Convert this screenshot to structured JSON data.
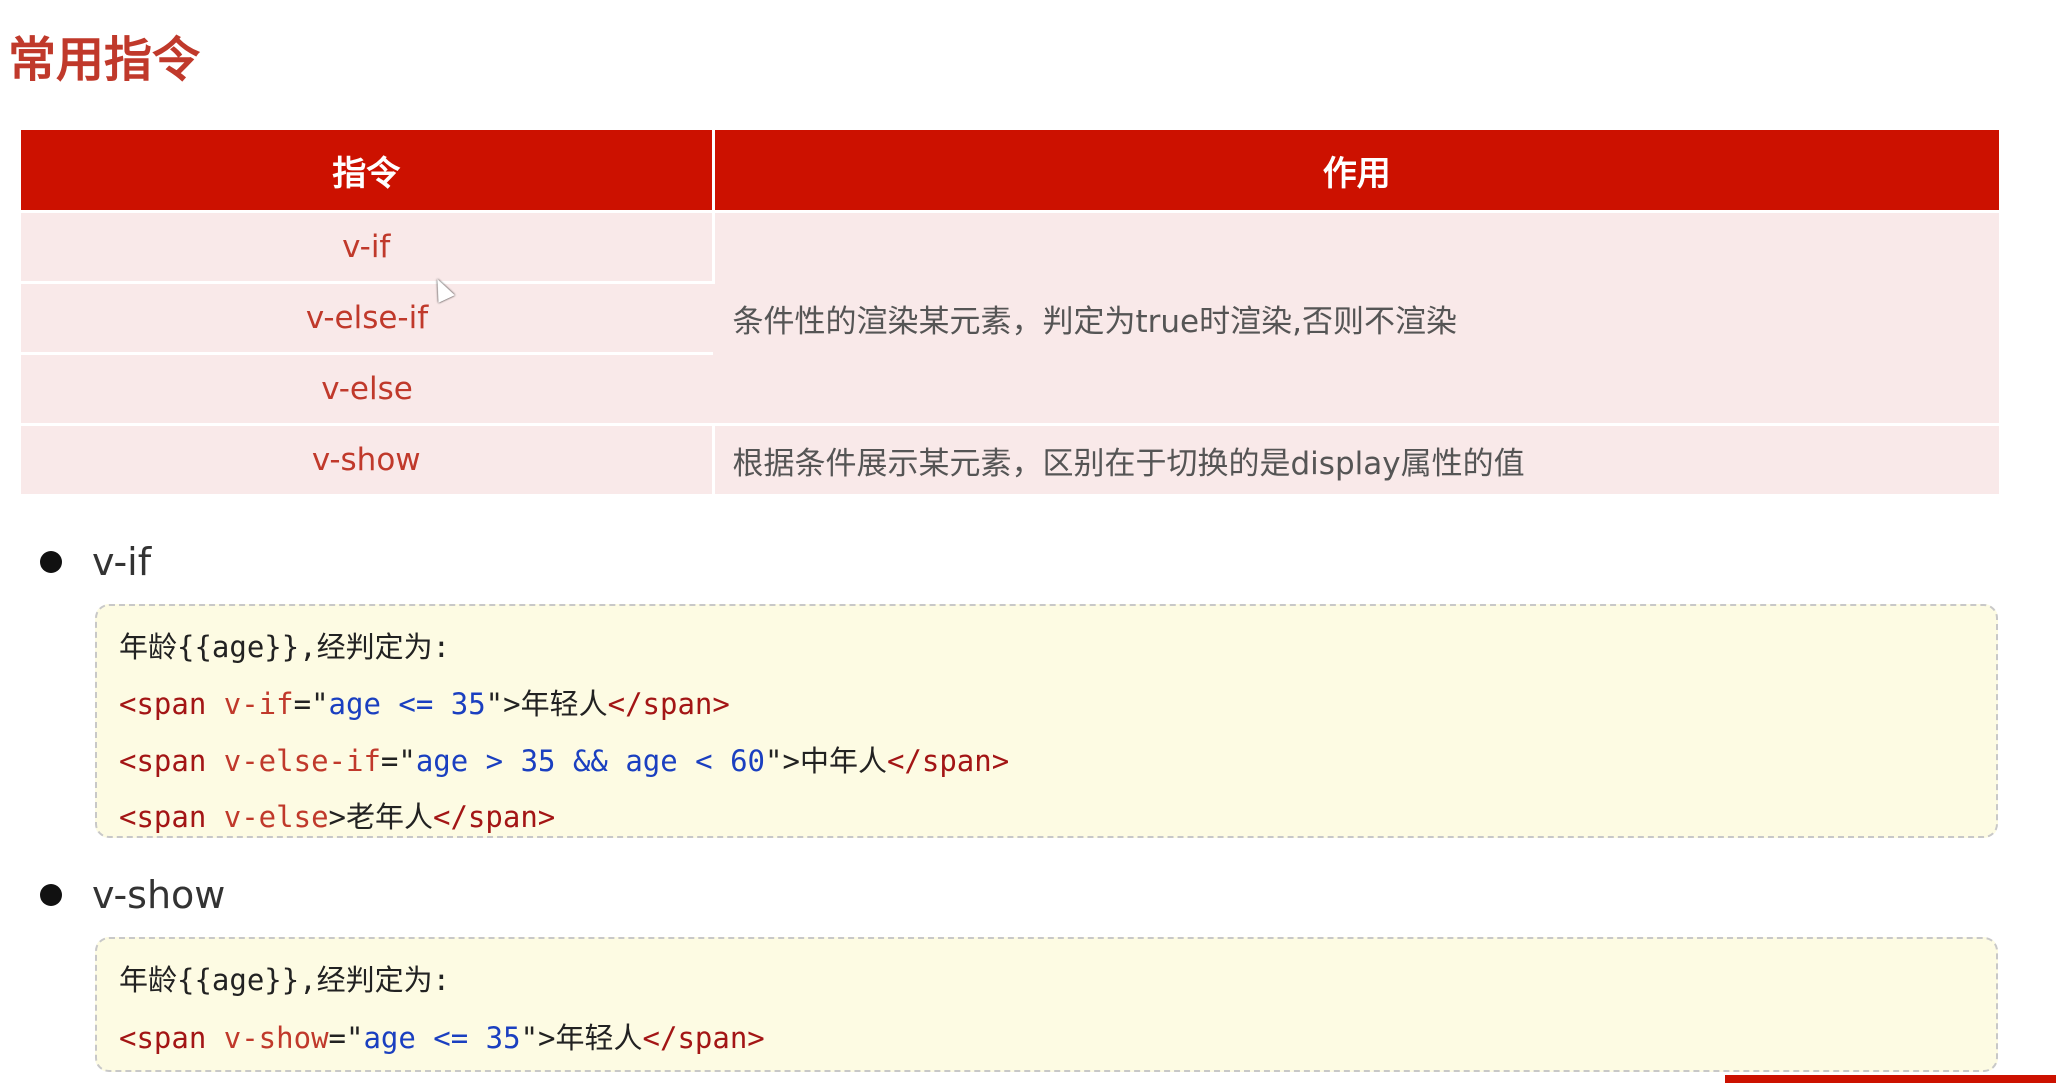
{
  "title": "常用指令",
  "table": {
    "headers": [
      "指令",
      "作用"
    ],
    "rows": [
      {
        "directive": "v-if"
      },
      {
        "directive": "v-else-if"
      },
      {
        "directive": "v-else"
      },
      {
        "directive": "v-show",
        "description": "根据条件展示某元素，区别在于切换的是display属性的值"
      }
    ],
    "merged_description": "条件性的渲染某元素，判定为true时渲染,否则不渲染"
  },
  "sections": [
    {
      "heading": "v-if",
      "code_lines": [
        [
          {
            "t": "年龄{{age}},经判定为:",
            "c": "plain"
          }
        ],
        [
          {
            "t": "<span ",
            "c": "tag"
          },
          {
            "t": "v-if",
            "c": "attr"
          },
          {
            "t": "=\"",
            "c": "plain"
          },
          {
            "t": "age <= 35",
            "c": "str"
          },
          {
            "t": "\">",
            "c": "plain"
          },
          {
            "t": "年轻人",
            "c": "plain"
          },
          {
            "t": "</span>",
            "c": "tag"
          }
        ],
        [
          {
            "t": "<span ",
            "c": "tag"
          },
          {
            "t": "v-else-if",
            "c": "attr"
          },
          {
            "t": "=\"",
            "c": "plain"
          },
          {
            "t": "age > 35 && age < 60",
            "c": "str"
          },
          {
            "t": "\">",
            "c": "plain"
          },
          {
            "t": "中年人",
            "c": "plain"
          },
          {
            "t": "</span>",
            "c": "tag"
          }
        ],
        [
          {
            "t": "<span ",
            "c": "tag"
          },
          {
            "t": "v-else",
            "c": "attr"
          },
          {
            "t": ">",
            "c": "plain"
          },
          {
            "t": "老年人",
            "c": "plain"
          },
          {
            "t": "</span>",
            "c": "tag"
          }
        ]
      ]
    },
    {
      "heading": "v-show",
      "code_lines": [
        [
          {
            "t": "年龄{{age}},经判定为:",
            "c": "plain"
          }
        ],
        [
          {
            "t": "<span ",
            "c": "tag"
          },
          {
            "t": "v-show",
            "c": "attr"
          },
          {
            "t": "=\"",
            "c": "plain"
          },
          {
            "t": "age <= 35",
            "c": "str"
          },
          {
            "t": "\">",
            "c": "plain"
          },
          {
            "t": "年轻人",
            "c": "plain"
          },
          {
            "t": "</span>",
            "c": "tag"
          }
        ]
      ]
    }
  ],
  "colors": {
    "header_bg": "#cc1100",
    "row_bg": "#f9e9e9",
    "directive_text": "#c0392b",
    "code_bg": "#fdfbe3",
    "code_string": "#1a3fc0"
  }
}
